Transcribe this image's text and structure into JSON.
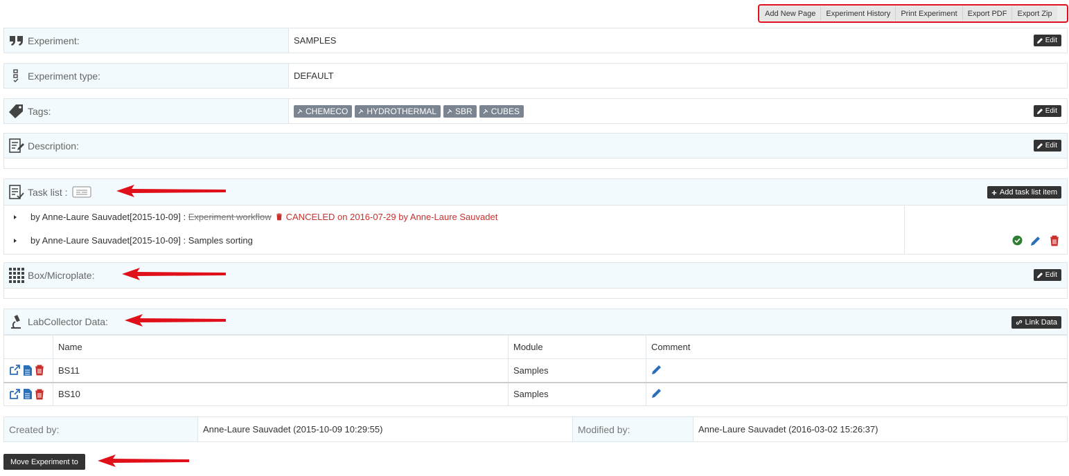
{
  "toolbar": {
    "add_new_page": "Add New Page",
    "experiment_history": "Experiment History",
    "print_experiment": "Print Experiment",
    "export_pdf": "Export PDF",
    "export_zip": "Export Zip"
  },
  "experiment": {
    "label": "Experiment:",
    "value": "SAMPLES",
    "edit": "Edit"
  },
  "experiment_type": {
    "label": "Experiment type:",
    "value": "DEFAULT"
  },
  "tags": {
    "label": "Tags:",
    "edit": "Edit",
    "items": [
      "CHEMECO",
      "HYDROTHERMAL",
      "SBR",
      "CUBES"
    ]
  },
  "description": {
    "label": "Description:",
    "edit": "Edit"
  },
  "task_list": {
    "label": "Task list :",
    "add_button": "Add task list item",
    "items": [
      {
        "by": "by Anne-Laure Sauvadet[2015-10-09] :",
        "title": "Experiment workflow",
        "status": "CANCELED on 2016-07-29 by Anne-Laure Sauvadet"
      },
      {
        "by": "by Anne-Laure Sauvadet[2015-10-09] :",
        "title": "Samples sorting"
      }
    ]
  },
  "box": {
    "label": "Box/Microplate:",
    "edit": "Edit"
  },
  "labcollector": {
    "label": "LabCollector Data:",
    "link_button": "Link Data",
    "columns": [
      "Name",
      "Module",
      "Comment"
    ],
    "rows": [
      {
        "name": "BS11",
        "module": "Samples"
      },
      {
        "name": "BS10",
        "module": "Samples"
      }
    ]
  },
  "footer": {
    "created_label": "Created by:",
    "created_value": "Anne-Laure Sauvadet (2015-10-09 10:29:55)",
    "modified_label": "Modified by:",
    "modified_value": "Anne-Laure Sauvadet (2016-03-02 15:26:37)"
  },
  "move_button": "Move Experiment to",
  "colors": {
    "accent_red": "#e0101a",
    "dark_button": "#333333",
    "tag_bg": "#7b8592",
    "label_bg": "#f3fafd",
    "link_blue": "#2a6fb8",
    "danger": "#c9302c",
    "success": "#2e7d32"
  }
}
